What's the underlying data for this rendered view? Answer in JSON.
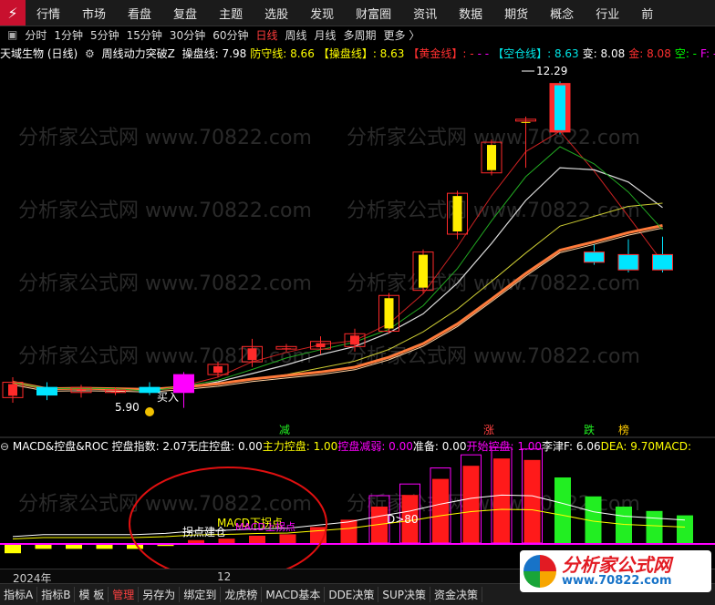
{
  "menu": [
    "行情",
    "市场",
    "看盘",
    "复盘",
    "主题",
    "选股",
    "发现",
    "财富圈",
    "资讯",
    "数据",
    "期货",
    "概念",
    "行业",
    "前"
  ],
  "periods": [
    {
      "label": "分时",
      "active": false
    },
    {
      "label": "1分钟",
      "active": false
    },
    {
      "label": "5分钟",
      "active": false
    },
    {
      "label": "15分钟",
      "active": false
    },
    {
      "label": "30分钟",
      "active": false
    },
    {
      "label": "60分钟",
      "active": false
    },
    {
      "label": "日线",
      "active": true
    },
    {
      "label": "周线",
      "active": false
    },
    {
      "label": "月线",
      "active": false
    },
    {
      "label": "多周期",
      "active": false
    },
    {
      "label": "更多 〉",
      "active": false
    }
  ],
  "info": {
    "stock": "天域生物 (日线)",
    "indicator": "周线动力突破Z",
    "items": [
      {
        "text": "操盘线: 7.98",
        "color": "#ffffff"
      },
      {
        "text": "防守线: 8.66",
        "color": "#ffff00"
      },
      {
        "text": "【操盘线】: 8.63",
        "color": "#ffff00"
      },
      {
        "text": "【黄金线】: -",
        "color": "#ff3030"
      },
      {
        "text": "- -",
        "color": "#ff00ff"
      },
      {
        "text": "【空仓线】: 8.63",
        "color": "#00e5e5"
      },
      {
        "text": "变: 8.08",
        "color": "#ffffff"
      },
      {
        "text": "金: 8.08",
        "color": "#ff3030"
      },
      {
        "text": "空: -",
        "color": "#00ff00"
      },
      {
        "text": "F: -",
        "color": "#ff00ff"
      }
    ]
  },
  "annotations": {
    "high": "12.29",
    "low": "5.90",
    "buy": "买入",
    "pivot": "拐点建仓",
    "macd_low": "MACD下拐点",
    "macd_up": "MACD上拐点",
    "d80": "D>80",
    "sig_jian": "减",
    "sig_zhang": "涨",
    "sig_die": "跌",
    "sig_bang": "榜"
  },
  "watermark": "分析家公式网 www.70822.com",
  "indicator_line": {
    "name": "MACD&控盘&ROC",
    "items": [
      {
        "text": "控盘指数: 2.07",
        "color": "#ffffff"
      },
      {
        "text": "无庄控盘: 0.00",
        "color": "#ffffff"
      },
      {
        "text": "主力控盘: 1.00",
        "color": "#ffff00"
      },
      {
        "text": "控盘减弱: 0.00",
        "color": "#ff00ff"
      },
      {
        "text": "准备: 0.00",
        "color": "#ffffff"
      },
      {
        "text": "开始控盘: 1.00",
        "color": "#ff00ff"
      },
      {
        "text": "李津F: 6.06",
        "color": "#ffffff"
      },
      {
        "text": "DEA: 9.70",
        "color": "#ffff00"
      },
      {
        "text": "MACD:",
        "color": "#ffff00"
      }
    ]
  },
  "axis": {
    "year": "2024年",
    "month": "12"
  },
  "tabs": [
    {
      "label": "指标A",
      "active": false
    },
    {
      "label": "指标B",
      "active": false
    },
    {
      "label": "模 板",
      "active": false
    },
    {
      "label": "管理",
      "active": true
    },
    {
      "label": "另存为",
      "active": false
    },
    {
      "label": "绑定到",
      "active": false
    },
    {
      "label": "龙虎榜",
      "active": false
    },
    {
      "label": "MACD基本",
      "active": false
    },
    {
      "label": "DDE决策",
      "active": false
    },
    {
      "label": "SUP决策",
      "active": false
    },
    {
      "label": "资金决策",
      "active": false
    }
  ],
  "brand": {
    "name": "分析家公式网",
    "url": "www.70822.com"
  },
  "candles": [
    {
      "o": 6.1,
      "c": 6.4,
      "h": 6.5,
      "l": 6.0
    },
    {
      "o": 6.3,
      "c": 6.15,
      "h": 6.4,
      "l": 6.05
    },
    {
      "o": 6.2,
      "c": 6.3,
      "h": 6.35,
      "l": 6.1
    },
    {
      "o": 6.2,
      "c": 6.25,
      "h": 6.3,
      "l": 6.15
    },
    {
      "o": 6.3,
      "c": 6.2,
      "h": 6.4,
      "l": 6.15
    },
    {
      "o": 6.2,
      "c": 6.55,
      "h": 6.6,
      "l": 5.9
    },
    {
      "o": 6.55,
      "c": 6.75,
      "h": 6.8,
      "l": 6.5
    },
    {
      "o": 6.8,
      "c": 7.1,
      "h": 7.25,
      "l": 6.7
    },
    {
      "o": 7.05,
      "c": 7.1,
      "h": 7.15,
      "l": 7.0
    },
    {
      "o": 7.05,
      "c": 7.2,
      "h": 7.3,
      "l": 6.95
    },
    {
      "o": 7.1,
      "c": 7.35,
      "h": 7.45,
      "l": 7.0
    },
    {
      "o": 7.4,
      "c": 8.1,
      "h": 8.15,
      "l": 7.35
    },
    {
      "o": 8.2,
      "c": 8.95,
      "h": 9.0,
      "l": 8.15
    },
    {
      "o": 9.3,
      "c": 10.1,
      "h": 10.15,
      "l": 9.2
    },
    {
      "o": 10.5,
      "c": 11.1,
      "h": 11.15,
      "l": 10.45
    },
    {
      "o": 11.55,
      "c": 11.55,
      "h": 11.6,
      "l": 10.6
    },
    {
      "o": 12.25,
      "c": 11.3,
      "h": 12.29,
      "l": 11.25
    },
    {
      "o": 8.95,
      "c": 8.75,
      "h": 9.1,
      "l": 8.7
    },
    {
      "o": 8.6,
      "c": 8.9,
      "h": 9.2,
      "l": 8.55
    },
    {
      "o": 8.9,
      "c": 8.6,
      "h": 9.25,
      "l": 8.55
    }
  ],
  "macd_bars": [
    -0.7,
    -0.4,
    -0.4,
    -0.4,
    -0.4,
    -0.2,
    0.2,
    0.3,
    0.5,
    0.6,
    1.1,
    1.6,
    2.5,
    3.3,
    4.4,
    5.3,
    5.8,
    5.7,
    4.5,
    3.2,
    2.5,
    2.2,
    1.9
  ]
}
